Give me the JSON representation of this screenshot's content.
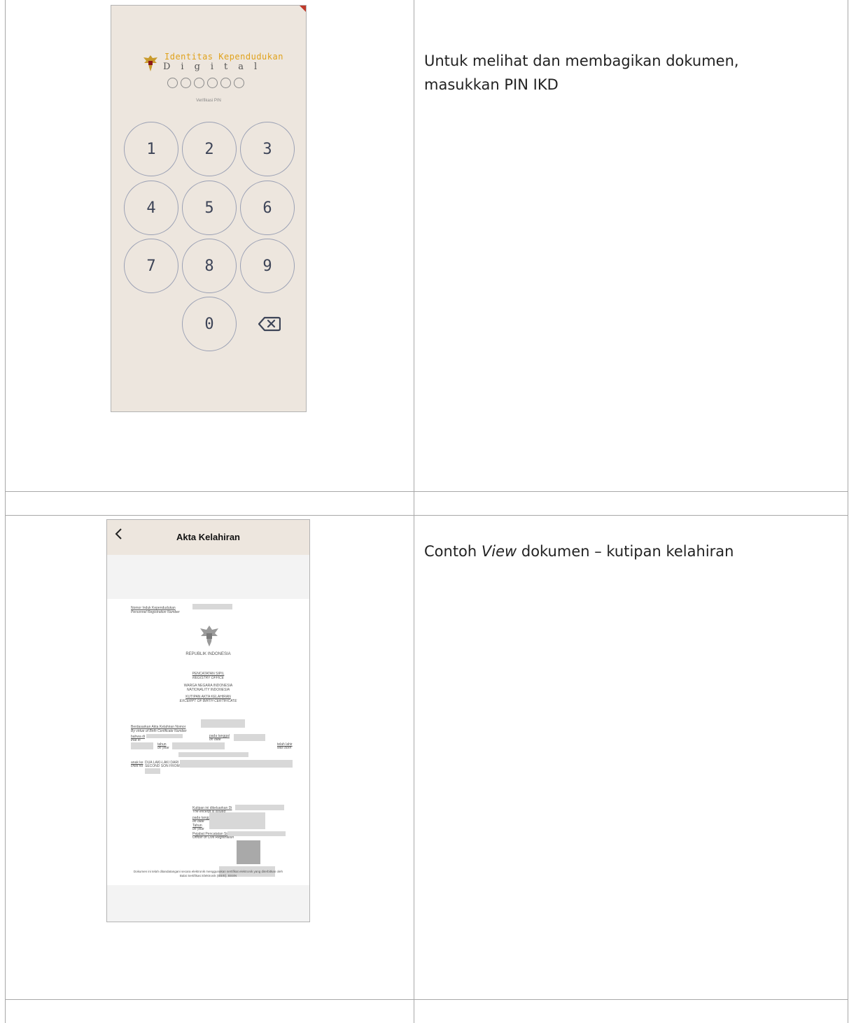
{
  "row1": {
    "description": "Untuk melihat dan membagikan dokumen, masukkan PIN IKD",
    "pin_screen": {
      "title_line1": "Identitas Kependudukan",
      "title_line2": "Digital",
      "subtitle": "Verifikasi PIN",
      "keys": [
        "1",
        "2",
        "3",
        "4",
        "5",
        "6",
        "7",
        "8",
        "9",
        "0"
      ],
      "pin_slots": 6,
      "accent_color": "#e0a21c"
    }
  },
  "row2": {
    "description_prefix": "Contoh ",
    "description_em": "View",
    "description_suffix": " dokumen – kutipan kelahiran",
    "app": {
      "title": "Akta Kelahiran",
      "doc": {
        "nik_label": "Nomor Induk Kependudukan",
        "nik_label_en": "Personnel Registration Number",
        "republic": "REPUBLIK INDONESIA",
        "office": "PENCATATAN SIPIL",
        "office_en": "REGISTRY OFFICE",
        "nationality": "WARGA NEGARA INDONESIA",
        "nationality_en": "NATIONALITY INDONESIA",
        "doc_title": "KUTIPAN AKTA KELAHIRAN",
        "doc_title_en": "EXCERPT OF BIRTH CERTIFICATE",
        "based_on": "Berdasarkan Akta Kelahiran Nomor",
        "based_on_en": "By virtue of Birth Certificate Number",
        "that_in": "bahwa di",
        "that_in_en": "that in",
        "on_date": "pada tanggal",
        "on_date_en": "on date",
        "year": "tahun",
        "year_en": "on year",
        "was_born": "telah lahir",
        "was_born_en": "was born",
        "child_no": "anak ke",
        "child_no_en": "child no",
        "child_value": "DUA LAKI-LAKI DARI",
        "child_value_en": "SECOND SON FROM",
        "issued_at": "Kutipan ini dikeluarkan Di",
        "issued_at_en": "The excerpt is issued",
        "issue_date": "pada tanggal",
        "issue_date_en": "on date",
        "issue_year": "Tahun",
        "issue_year_en": "on year",
        "officer": "Pejabat Pencatatan Sipil",
        "officer_en": "Officer of Civil Registration",
        "footer1": "Dokumen ini telah ditandatangani secara elektronik menggunakan sertifikat elektronik yang diterbitkan oleh",
        "footer2": "Balai Sertifikasi Elektronik (BSrE), BSSN"
      }
    }
  }
}
